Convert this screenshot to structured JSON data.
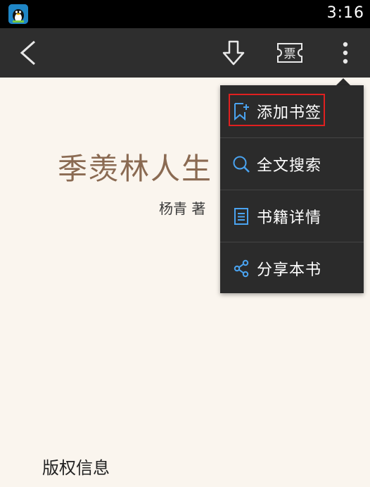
{
  "status_bar": {
    "time": "3:16",
    "app_icon": "qq-penguin-icon"
  },
  "toolbar": {
    "back_icon": "chevron-left-icon",
    "download_icon": "download-arrow-icon",
    "ticket_label": "票",
    "more_icon": "more-vertical-icon"
  },
  "book": {
    "title": "季羡林人生",
    "author": "杨青  著",
    "copyright_label": "版权信息"
  },
  "menu": {
    "items": [
      {
        "label": "添加书签",
        "icon": "bookmark-add-icon",
        "highlighted": true
      },
      {
        "label": "全文搜索",
        "icon": "search-icon"
      },
      {
        "label": "书籍详情",
        "icon": "document-icon"
      },
      {
        "label": "分享本书",
        "icon": "share-icon"
      }
    ]
  },
  "colors": {
    "toolbar_bg": "#2e2e2e",
    "page_bg": "#faf5ee",
    "title_color": "#8a6a52",
    "menu_bg": "#2b2b2b",
    "icon_accent": "#4aa3f0",
    "highlight_border": "#e02020"
  }
}
